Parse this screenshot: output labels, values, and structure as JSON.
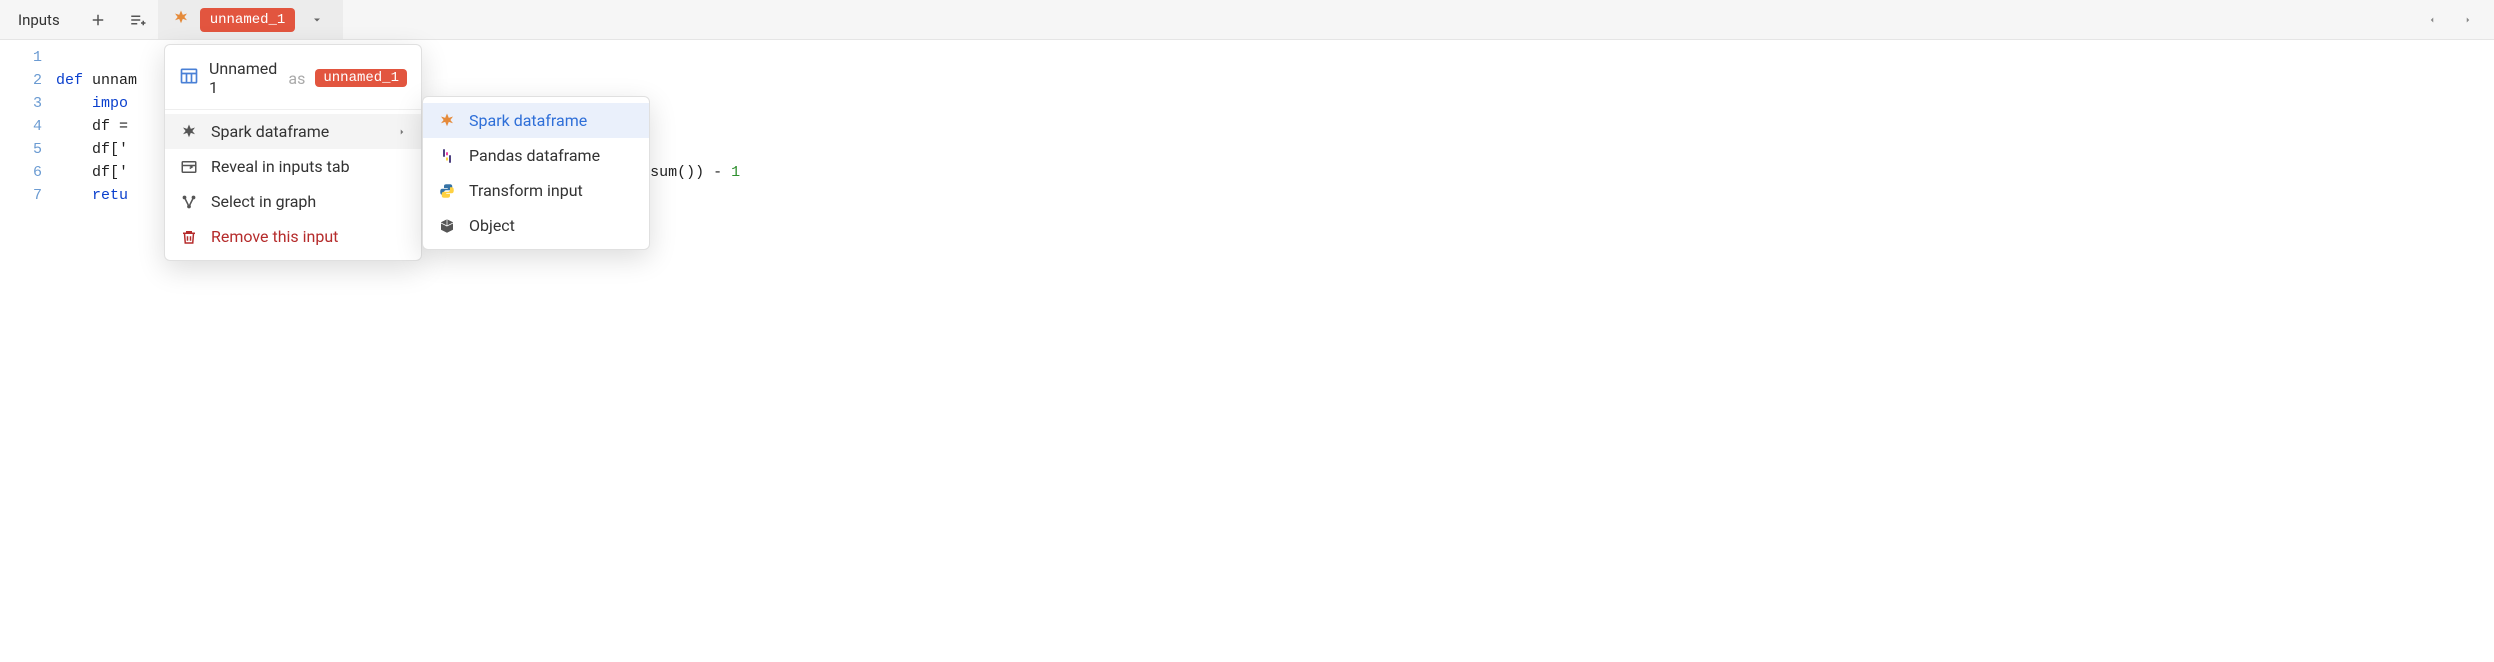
{
  "toolbar": {
    "inputs_label": "Inputs",
    "tab": {
      "alias": "unnamed_1"
    }
  },
  "code": {
    "lines": [
      "1",
      "2",
      "3",
      "4",
      "5",
      "6",
      "7"
    ],
    "line1_kw": "def",
    "line1_rest": " unnam",
    "line2_kw": "    impo",
    "line3": "    df =",
    "line4": "    df['",
    "line5_a": "    df['",
    "line5_b": "']).cumsum()) - ",
    "line5_num": "1",
    "line6_kw": "    retu"
  },
  "menu_primary": {
    "header_title": "Unnamed 1",
    "header_as": "as",
    "header_alias": "unnamed_1",
    "items": {
      "spark": "Spark dataframe",
      "reveal": "Reveal in inputs tab",
      "select": "Select in graph",
      "remove": "Remove this input"
    }
  },
  "menu_secondary": {
    "items": {
      "spark": "Spark dataframe",
      "pandas": "Pandas dataframe",
      "transform": "Transform input",
      "object": "Object"
    }
  }
}
